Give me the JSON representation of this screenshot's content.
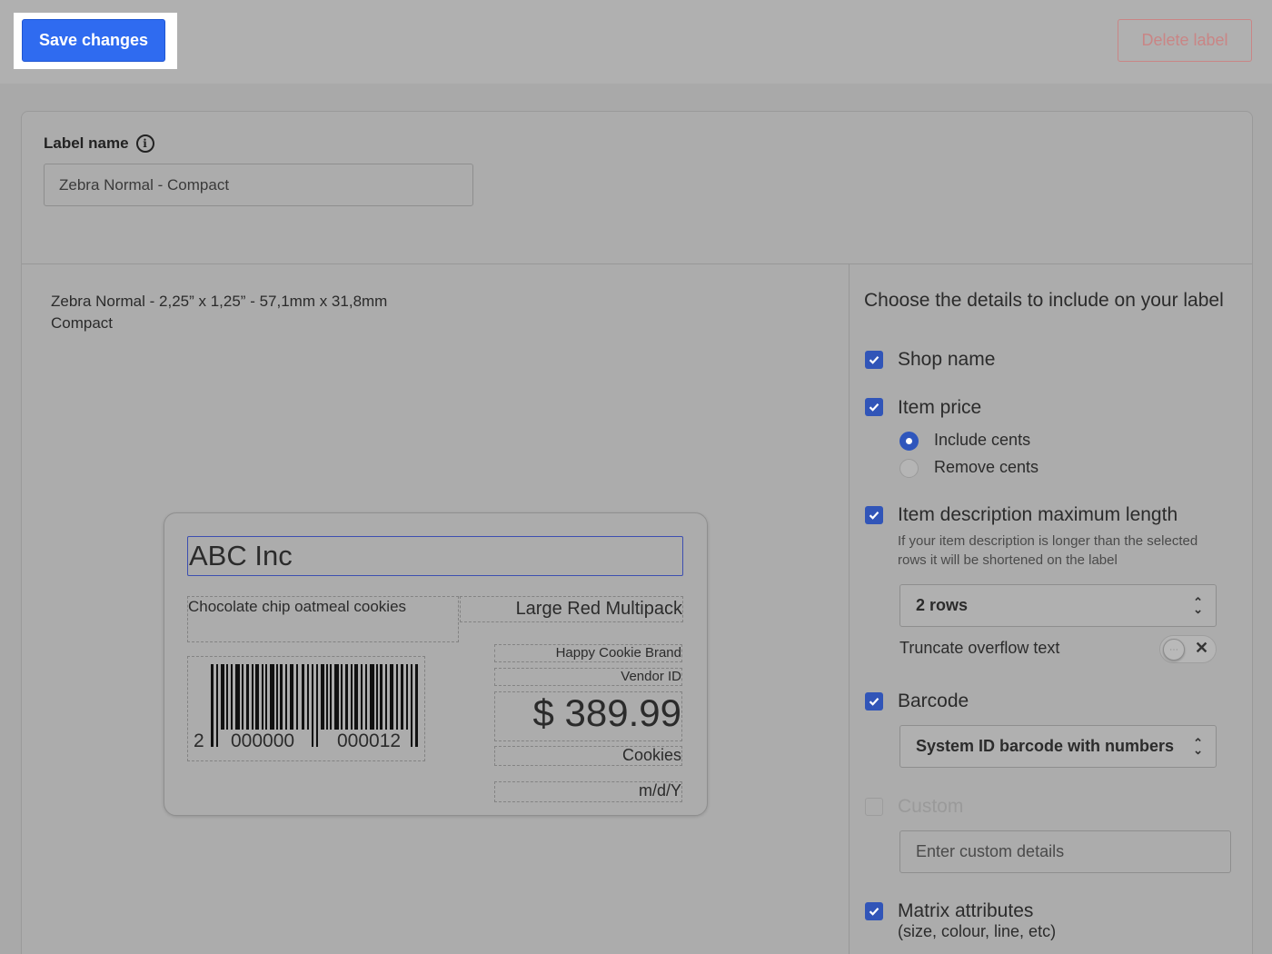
{
  "toolbar": {
    "save_label": "Save changes",
    "delete_label": "Delete label"
  },
  "label_name": {
    "title": "Label name",
    "info_icon": "info-icon",
    "value": "Zebra Normal - Compact"
  },
  "spec": {
    "line1": "Zebra Normal - 2,25” x 1,25” - 57,1mm x 31,8mm",
    "line2": "Compact"
  },
  "preview": {
    "shop_name": "ABC Inc",
    "description": "Chocolate chip oatmeal cookies",
    "matrix": "Large Red Multipack",
    "brand": "Happy Cookie Brand",
    "vendor": "Vendor ID",
    "price": "$ 389.99",
    "category": "Cookies",
    "date": "m/d/Y",
    "barcode_digits": {
      "first": "2",
      "left": "000000",
      "right": "000012"
    }
  },
  "panel": {
    "title": "Choose the details to include on your label",
    "shop_name": {
      "label": "Shop name",
      "checked": true
    },
    "item_price": {
      "label": "Item price",
      "checked": true,
      "options": [
        "Include cents",
        "Remove cents"
      ],
      "selected": "Include cents"
    },
    "description": {
      "label": "Item description maximum length",
      "checked": true,
      "helper1": "If your item description is longer than the selected",
      "helper2": "rows it will be shortened on the label",
      "rows_value": "2 rows",
      "truncate_label": "Truncate overflow text",
      "truncate_on": false
    },
    "barcode": {
      "label": "Barcode",
      "checked": true,
      "value": "System ID barcode with numbers"
    },
    "custom": {
      "label": "Custom",
      "checked": false,
      "placeholder": "Enter custom details"
    },
    "matrix": {
      "label": "Matrix attributes",
      "sublabel": "(size, colour, line, etc)",
      "checked": true
    }
  },
  "colors": {
    "accent": "#2f6bf0",
    "checkbox": "#3155b8",
    "danger": "#c98585",
    "overlay": "#a9a9a9"
  }
}
